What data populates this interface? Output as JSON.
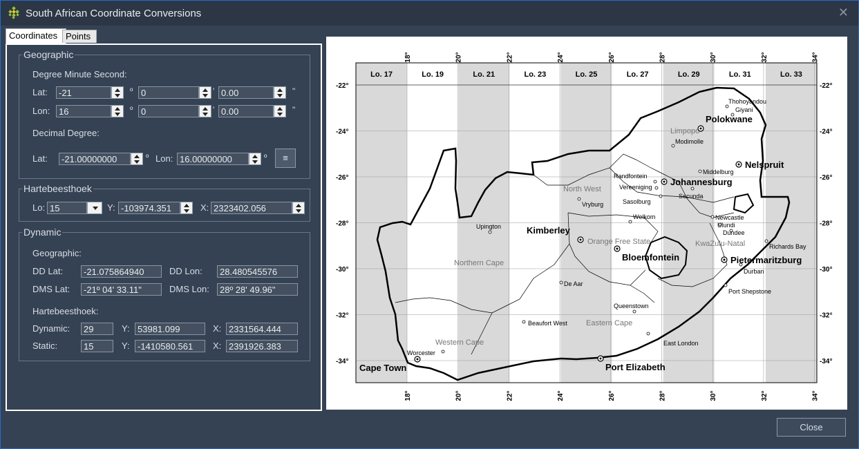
{
  "window": {
    "title": "South African Coordinate Conversions"
  },
  "tabs": [
    "Coordinates",
    "Points"
  ],
  "geographic": {
    "title": "Geographic",
    "dms_label": "Degree Minute Second:",
    "lat_label": "Lat:",
    "lon_label": "Lon:",
    "lat_deg": "-21",
    "lat_min": "0",
    "lat_sec": "0.00",
    "lon_deg": "16",
    "lon_min": "0",
    "lon_sec": "0.00",
    "deg_symbol": "º",
    "min_symbol": "'",
    "sec_symbol": "\"",
    "dd_label": "Decimal Degree:",
    "dd_lat_label": "Lat:",
    "dd_lat": "-21.00000000",
    "dd_lon_label": "Lon:",
    "dd_lon": "16.00000000",
    "calc_icon": "equals-icon"
  },
  "hartebeesthoek": {
    "title": "Hartebeesthoek",
    "lo_label": "Lo:",
    "lo_value": "15",
    "y_label": "Y:",
    "y_value": "-103974.351",
    "x_label": "X:",
    "x_value": "2323402.056"
  },
  "dynamic": {
    "title": "Dynamic",
    "geo_label": "Geographic:",
    "dd_lat_label": "DD Lat:",
    "dd_lat": "-21.075864940",
    "dd_lon_label": "DD Lon:",
    "dd_lon": "28.480545576",
    "dms_lat_label": "DMS Lat:",
    "dms_lat": "-21º 04' 33.11\"",
    "dms_lon_label": "DMS Lon:",
    "dms_lon": "28º 28' 49.96\"",
    "hart_label": "Hartebeesthoek:",
    "dyn_label": "Dynamic:",
    "dyn_lo": "29",
    "dyn_y_label": "Y:",
    "dyn_y": "53981.099",
    "dyn_x_label": "X:",
    "dyn_x": "2331564.444",
    "stat_label": "Static:",
    "stat_lo": "15",
    "stat_y_label": "Y:",
    "stat_y": "-1410580.561",
    "stat_x_label": "X:",
    "stat_x": "2391926.383"
  },
  "map": {
    "lo_bands": [
      "Lo. 17",
      "Lo. 19",
      "Lo. 21",
      "Lo. 23",
      "Lo. 25",
      "Lo. 27",
      "Lo. 29",
      "Lo. 31",
      "Lo. 33"
    ],
    "lon_ticks": [
      "18°",
      "20°",
      "22°",
      "24°",
      "26°",
      "28°",
      "30°",
      "32°",
      "34°"
    ],
    "lat_ticks": [
      "-22°",
      "-24°",
      "-26°",
      "-28°",
      "-30°",
      "-32°",
      "-34°"
    ],
    "cities_bold": [
      "Polokwane",
      "Nelspruit",
      "Johannesburg",
      "Kimberley",
      "Bloemfontein",
      "Pietermaritzburg",
      "Cape Town",
      "Port Elizabeth"
    ],
    "towns": [
      "Thohoyandou",
      "Giyani",
      "Modimolle",
      "Randfontein",
      "Vereeniging",
      "Sasolburg",
      "Middelburg",
      "Secunda",
      "Vryburg",
      "Welkom",
      "Newcastle",
      "Ulundi",
      "Dundee",
      "Upington",
      "Richards Bay",
      "Durban",
      "De Aar",
      "Port Shepstone",
      "Queenstown",
      "Beaufort West",
      "East London",
      "Worcester"
    ],
    "provinces": [
      "Limpopo",
      "North West",
      "Orange Free State",
      "KwaZulu-Natal",
      "Northern Cape",
      "Eastern Cape",
      "Western Cape"
    ]
  },
  "buttons": {
    "close": "Close"
  },
  "colors": {
    "accent": "#1e6fd0",
    "background": "#354253"
  }
}
